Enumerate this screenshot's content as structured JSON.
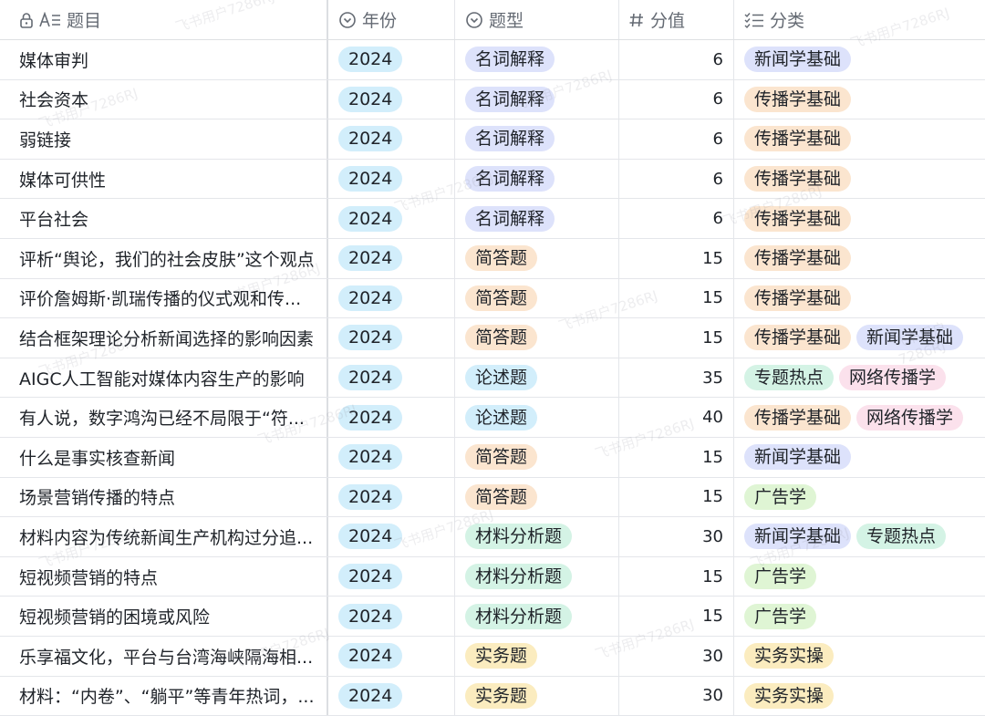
{
  "columns": {
    "title": "题目",
    "year": "年份",
    "type": "题型",
    "score": "分值",
    "category": "分类"
  },
  "tag_colors": {
    "year": "#d2eefb",
    "名词解释": "#dde2fb",
    "简答题": "#fbe5cf",
    "论述题": "#d2eefb",
    "材料分析题": "#d4f3e5",
    "实务题": "#fbecbf",
    "新闻学基础": "#dde2fb",
    "传播学基础": "#fbe5cf",
    "专题热点": "#d4f3e5",
    "网络传播学": "#fbe1ec",
    "广告学": "#dff5d4",
    "实务实操": "#fbecbf"
  },
  "rows": [
    {
      "title": "媒体审判",
      "year": "2024",
      "type": "名词解释",
      "score": "6",
      "categories": [
        "新闻学基础"
      ]
    },
    {
      "title": "社会资本",
      "year": "2024",
      "type": "名词解释",
      "score": "6",
      "categories": [
        "传播学基础"
      ]
    },
    {
      "title": "弱链接",
      "year": "2024",
      "type": "名词解释",
      "score": "6",
      "categories": [
        "传播学基础"
      ]
    },
    {
      "title": "媒体可供性",
      "year": "2024",
      "type": "名词解释",
      "score": "6",
      "categories": [
        "传播学基础"
      ]
    },
    {
      "title": "平台社会",
      "year": "2024",
      "type": "名词解释",
      "score": "6",
      "categories": [
        "传播学基础"
      ]
    },
    {
      "title": "评析“舆论，我们的社会皮肤”这个观点",
      "year": "2024",
      "type": "简答题",
      "score": "15",
      "categories": [
        "传播学基础"
      ]
    },
    {
      "title": "评价詹姆斯·凯瑞传播的仪式观和传...",
      "year": "2024",
      "type": "简答题",
      "score": "15",
      "categories": [
        "传播学基础"
      ]
    },
    {
      "title": "结合框架理论分析新闻选择的影响因素",
      "year": "2024",
      "type": "简答题",
      "score": "15",
      "categories": [
        "传播学基础",
        "新闻学基础"
      ]
    },
    {
      "title": "AIGC人工智能对媒体内容生产的影响",
      "year": "2024",
      "type": "论述题",
      "score": "35",
      "categories": [
        "专题热点",
        "网络传播学"
      ]
    },
    {
      "title": "有人说，数字鸿沟已经不局限于“符...",
      "year": "2024",
      "type": "论述题",
      "score": "40",
      "categories": [
        "传播学基础",
        "网络传播学"
      ]
    },
    {
      "title": "什么是事实核查新闻",
      "year": "2024",
      "type": "简答题",
      "score": "15",
      "categories": [
        "新闻学基础"
      ]
    },
    {
      "title": "场景营销传播的特点",
      "year": "2024",
      "type": "简答题",
      "score": "15",
      "categories": [
        "广告学"
      ]
    },
    {
      "title": "材料内容为传统新闻生产机构过分追...",
      "year": "2024",
      "type": "材料分析题",
      "score": "30",
      "categories": [
        "新闻学基础",
        "专题热点"
      ]
    },
    {
      "title": "短视频营销的特点",
      "year": "2024",
      "type": "材料分析题",
      "score": "15",
      "categories": [
        "广告学"
      ]
    },
    {
      "title": "短视频营销的困境或风险",
      "year": "2024",
      "type": "材料分析题",
      "score": "15",
      "categories": [
        "广告学"
      ]
    },
    {
      "title": "乐享福文化，平台与台湾海峡隔海相...",
      "year": "2024",
      "type": "实务题",
      "score": "30",
      "categories": [
        "实务实操"
      ]
    },
    {
      "title": "材料：“内卷”、“躺平”等青年热词，...",
      "year": "2024",
      "type": "实务题",
      "score": "30",
      "categories": [
        "实务实操"
      ]
    }
  ],
  "watermark": "飞书用户7286RJ"
}
